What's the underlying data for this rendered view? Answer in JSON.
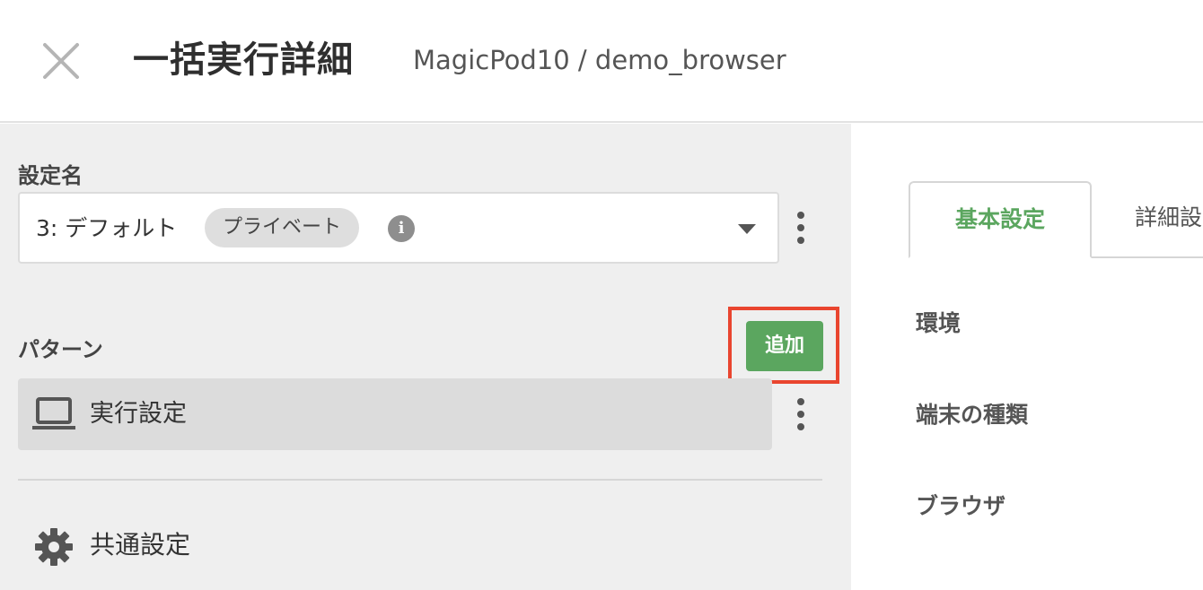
{
  "header": {
    "title": "一括実行詳細",
    "breadcrumb": "MagicPod10 / demo_browser"
  },
  "settings": {
    "label": "設定名",
    "selected_value": "3: デフォルト",
    "badge": "プライベート",
    "info_glyph": "i"
  },
  "pattern": {
    "label": "パターン",
    "add_button": "追加",
    "items": [
      {
        "label": "実行設定",
        "icon": "laptop-icon"
      }
    ]
  },
  "common": {
    "label": "共通設定",
    "icon": "gear-icon"
  },
  "tabs": [
    {
      "label": "基本設定",
      "active": true
    },
    {
      "label": "詳細設",
      "active": false
    }
  ],
  "fields": [
    {
      "label": "環境"
    },
    {
      "label": "端末の種類"
    },
    {
      "label": "ブラウザ"
    }
  ],
  "colors": {
    "accent_green": "#5ba65f",
    "highlight_red": "#e9452f",
    "panel_gray": "#efefef"
  }
}
